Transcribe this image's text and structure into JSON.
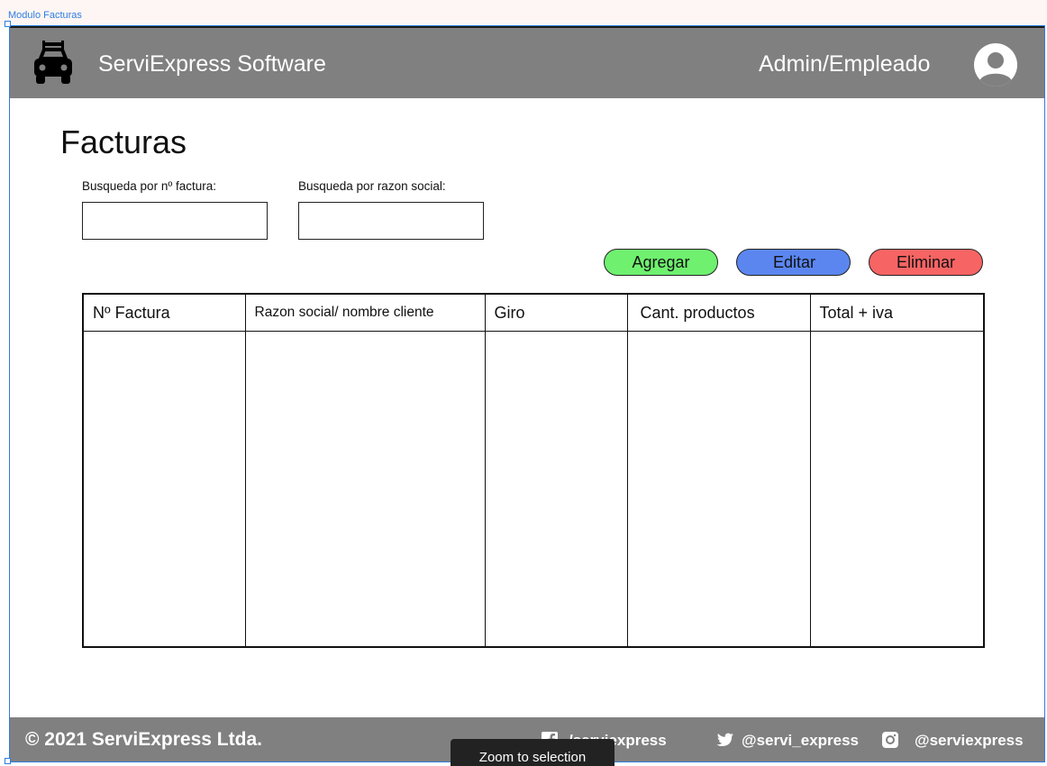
{
  "canvas": {
    "frame_label": "Modulo Facturas"
  },
  "header": {
    "app_title": "ServiExpress Software",
    "role_label": "Admin/Empleado"
  },
  "page": {
    "title": "Facturas"
  },
  "search": {
    "invoice_label": "Busqueda por nº factura:",
    "invoice_value": "",
    "company_label": "Busqueda por razon social:",
    "company_value": ""
  },
  "actions": {
    "add": "Agregar",
    "edit": "Editar",
    "delete": "Eliminar"
  },
  "table": {
    "columns": [
      "Nº Factura",
      "Razon social/ nombre cliente",
      "Giro",
      "Cant. productos",
      "Total + iva"
    ],
    "rows": []
  },
  "footer": {
    "copyright": "© 2021 ServiExpress Ltda.",
    "facebook": "/serviexpress",
    "twitter": "@servi_express",
    "instagram": "@serviexpress"
  },
  "tooltip": {
    "text": "Zoom to selection"
  },
  "colors": {
    "bar": "#808080",
    "selection": "#2f7de1",
    "add_button": "#6ff06f",
    "edit_button": "#5b86f0",
    "delete_button": "#f76464"
  },
  "icons": [
    "car-icon",
    "user-avatar-icon",
    "facebook-icon",
    "twitter-icon",
    "instagram-icon"
  ]
}
